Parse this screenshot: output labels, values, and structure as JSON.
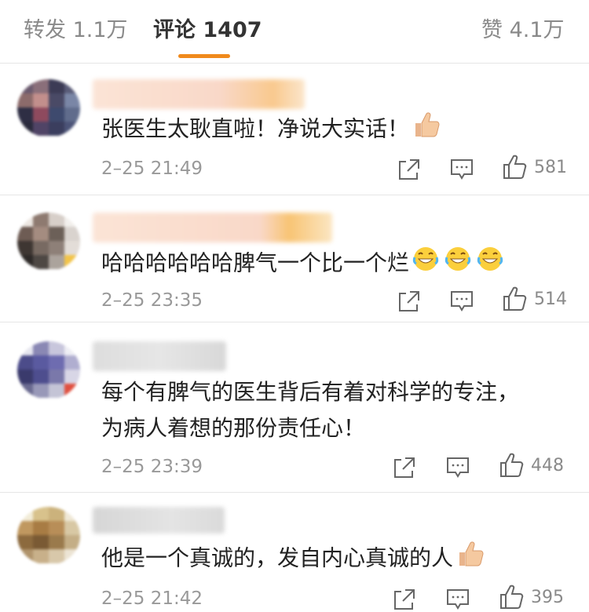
{
  "tabs": {
    "repost": "转发 1.1万",
    "comments": "评论 1407",
    "likes": "赞 4.1万"
  },
  "colors": {
    "accent": "#f08a1c",
    "text": "#222222",
    "muted": "#999999"
  },
  "comments": [
    {
      "text": "张医生太耿直啦！净说大实话！",
      "time": "2–25 21:49",
      "likes": "581",
      "emoji": "thumbs-up-icon"
    },
    {
      "text": "哈哈哈哈哈哈脾气一个比一个烂",
      "time": "2–25 23:35",
      "likes": "514",
      "emoji": "laugh-cry-icon"
    },
    {
      "text_lines": [
        "每个有脾气的医生背后有着对科学的专注，",
        "为病人着想的那份责任心！"
      ],
      "time": "2–25 23:39",
      "likes": "448"
    },
    {
      "text": "他是一个真诚的，发自内心真诚的人",
      "time": "2–25 21:42",
      "likes": "395",
      "emoji": "thumbs-up-icon"
    }
  ]
}
